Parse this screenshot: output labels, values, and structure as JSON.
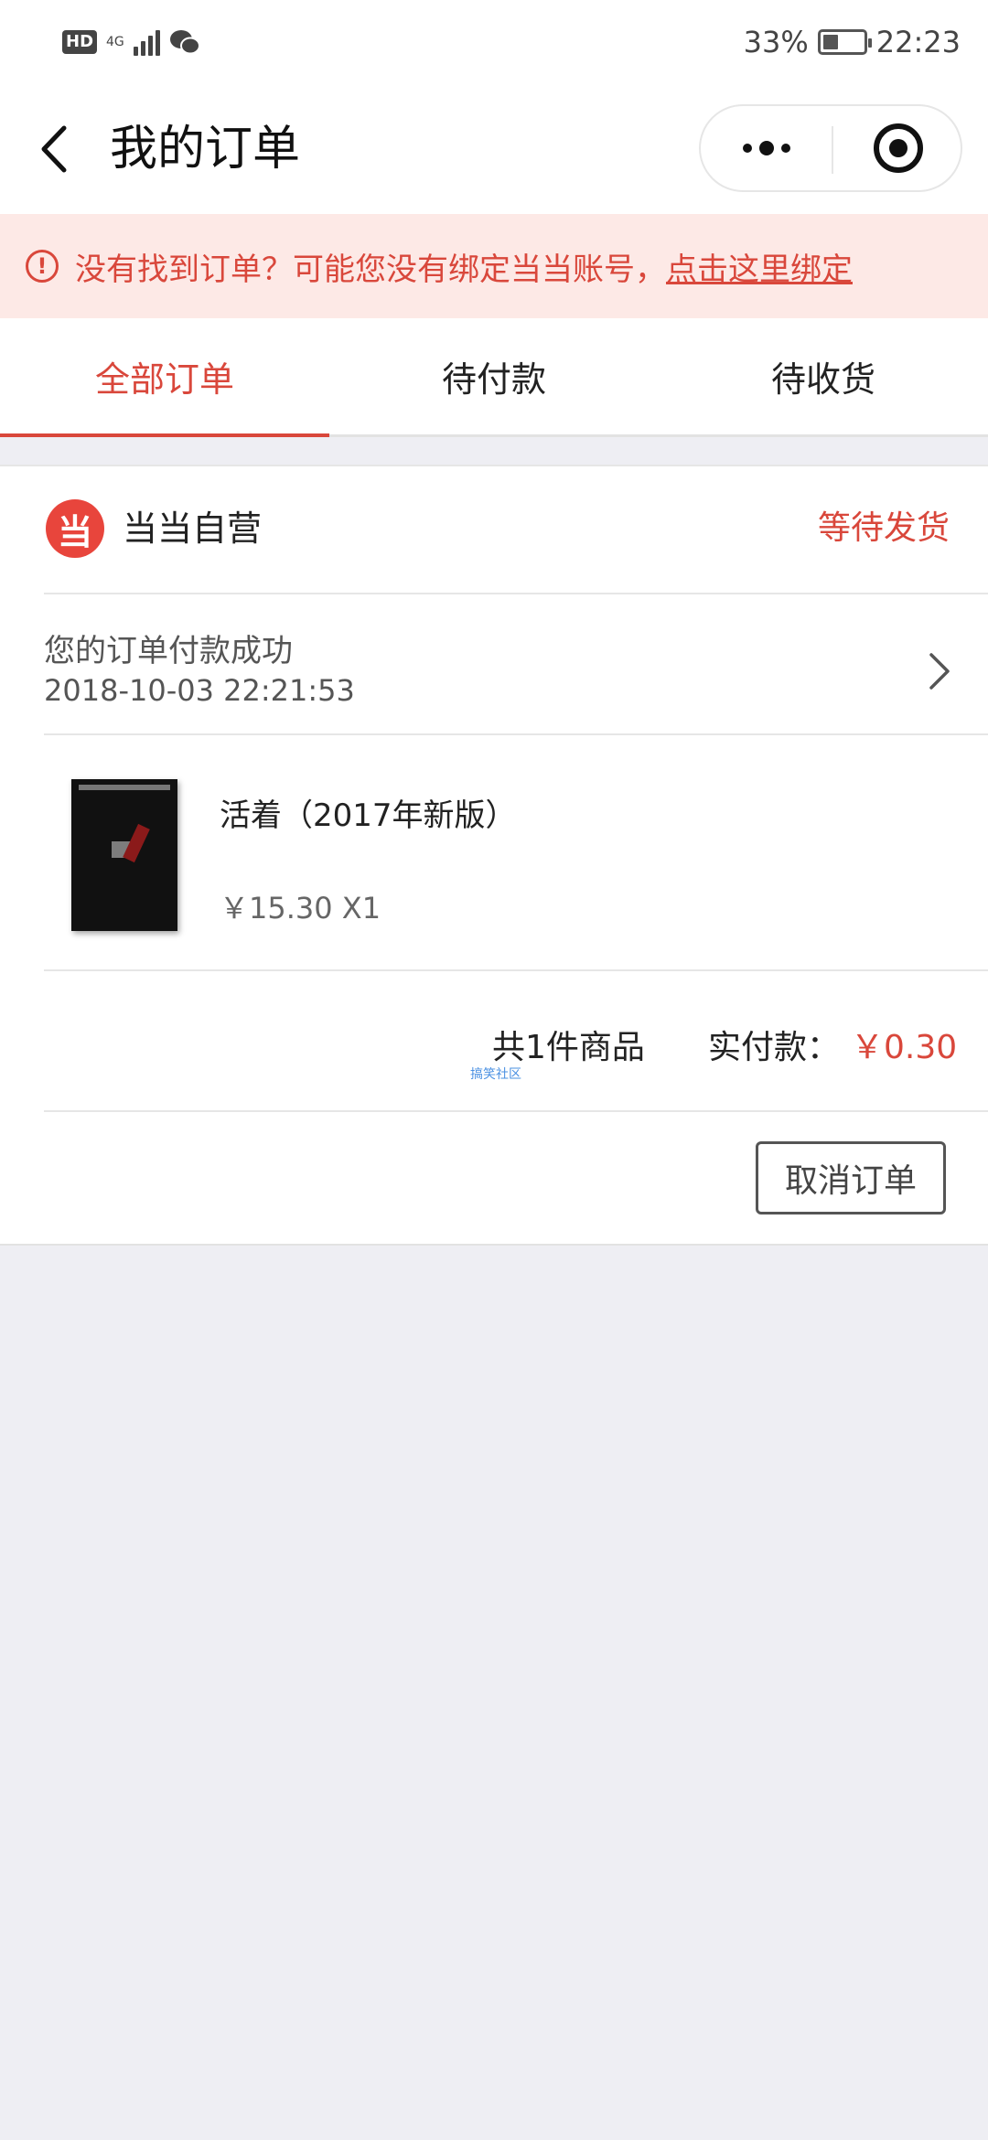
{
  "status_bar": {
    "hd": "HD",
    "network": "4G",
    "battery": "33%",
    "battery_level": 0.33,
    "time": "22:23"
  },
  "header": {
    "title": "我的订单"
  },
  "notice": {
    "icon": "!",
    "text": "没有找到订单？可能您没有绑定当当账号，",
    "link": "点击这里绑定"
  },
  "tabs": [
    {
      "label": "全部订单",
      "active": true
    },
    {
      "label": "待付款",
      "active": false
    },
    {
      "label": "待收货",
      "active": false
    }
  ],
  "order": {
    "shop_logo": "当",
    "shop_name": "当当自营",
    "status": "等待发货",
    "pay_message": "您的订单付款成功",
    "pay_time": "2018-10-03 22:21:53",
    "product": {
      "name": "活着（2017年新版）",
      "price": "￥15.30 X1"
    },
    "summary": {
      "count": "共1件商品",
      "paid_label": "实付款：",
      "paid_amount": "￥0.30"
    },
    "watermark": "搞笑社区",
    "cancel_label": "取消订单"
  },
  "colors": {
    "accent": "#d9473b",
    "notice_bg": "#fde9e6",
    "page_bg": "#eeeef3"
  }
}
